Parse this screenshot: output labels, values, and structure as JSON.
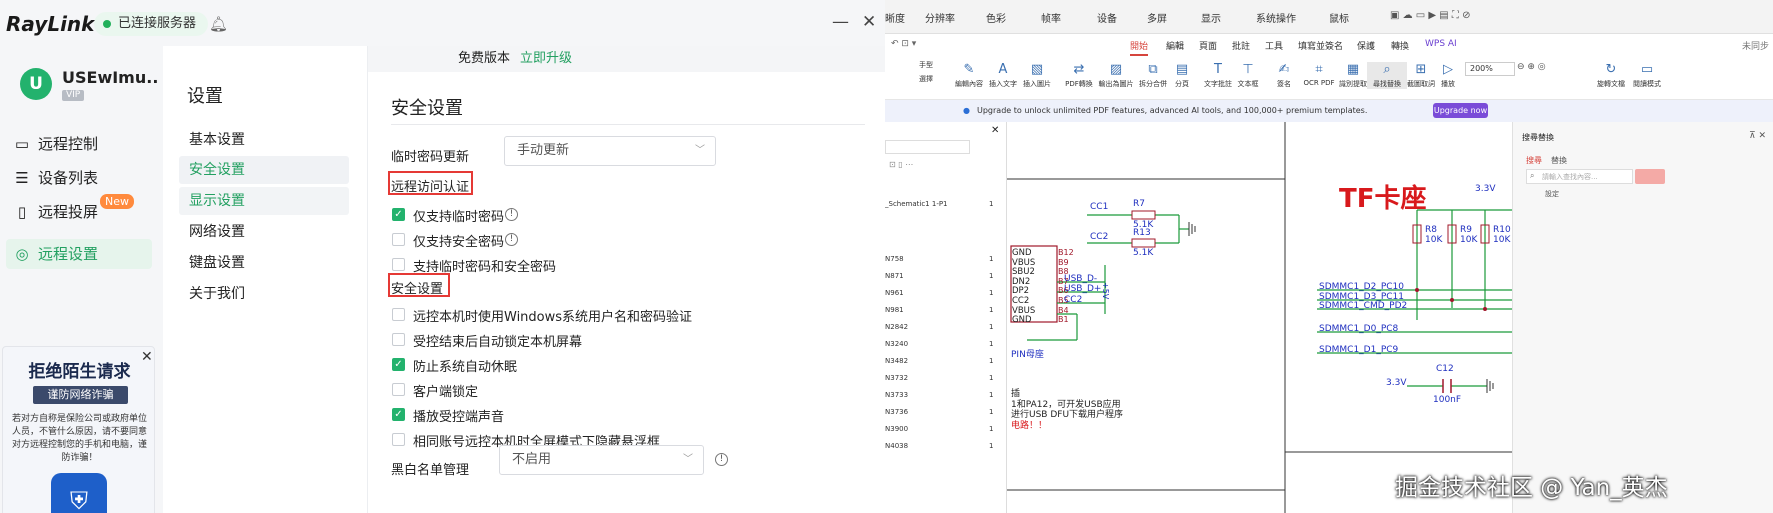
{
  "raylink": {
    "logo": "RayLink",
    "status": "已连接服务器",
    "user": {
      "initial": "U",
      "name": "USEwImu..",
      "badge": "VIP"
    },
    "nav": [
      {
        "label": "远程控制",
        "icon": "monitor-icon"
      },
      {
        "label": "设备列表",
        "icon": "list-icon"
      },
      {
        "label": "远程投屏",
        "icon": "cast-icon"
      },
      {
        "label": "远程设置",
        "icon": "settings-icon",
        "active": true
      }
    ],
    "new_badge": "New",
    "ad": {
      "title": "拒绝陌生请求",
      "subtitle": "谨防网络诈骗",
      "body": "若对方自称是保险公司或政府单位人员，不管什么原因，请不要同意对方远程控制您的手机和电脑，谨防诈骗！"
    },
    "banner": {
      "edition": "免费版本",
      "upgrade": "立即升级"
    },
    "submenu": {
      "title": "设置",
      "items": [
        "基本设置",
        "安全设置",
        "显示设置",
        "网络设置",
        "键盘设置",
        "关于我们"
      ]
    },
    "main": {
      "title": "安全设置",
      "temp_pwd_label": "临时密码更新",
      "temp_pwd_value": "手动更新",
      "section_auth": "远程访问认证",
      "auth_options": [
        {
          "label": "仅支持临时密码",
          "checked": true,
          "info": true
        },
        {
          "label": "仅支持安全密码",
          "checked": false,
          "info": true
        },
        {
          "label": "支持临时密码和安全密码",
          "checked": false,
          "info": false
        }
      ],
      "section_security": "安全设置",
      "security_options": [
        {
          "label": "远控本机时使用Windows系统用户名和密码验证",
          "checked": false
        },
        {
          "label": "受控结束后自动锁定本机屏幕",
          "checked": false
        },
        {
          "label": "防止系统自动休眠",
          "checked": true
        },
        {
          "label": "客户端锁定",
          "checked": false
        },
        {
          "label": "播放受控端声音",
          "checked": true
        },
        {
          "label": "相同账号远控本机时全屏模式下隐藏悬浮框",
          "checked": false
        }
      ],
      "blacklist_label": "黑白名单管理",
      "blacklist_value": "不启用"
    }
  },
  "pdf": {
    "top_toolbar": [
      "晰度",
      "分辨率",
      "色彩",
      "帧率",
      "设备",
      "多屏",
      "显示",
      "系统操作",
      "鼠标"
    ],
    "menus": [
      "開始",
      "編輯",
      "頁面",
      "批註",
      "工具",
      "填寫並簽名",
      "保護",
      "轉換",
      "WPS AI"
    ],
    "unsynced": "未同步",
    "tools": [
      "手型",
      "選擇",
      "編輯內容",
      "插入文字",
      "插入圖片",
      "PDF轉換",
      "輸出為圖片",
      "拆分合併",
      "分頁",
      "文字批註",
      "文本框",
      "簽名",
      "OCR PDF",
      "識別提取",
      "尋找替換",
      "截圖取詞",
      "播放",
      "旋轉文檔",
      "閱讀模式"
    ],
    "zoom": "200%",
    "upgrade_text": "Upgrade to unlock unlimited PDF features, advanced AI tools, and 100,000+ premium templates.",
    "upgrade_btn": "Upgrade now",
    "nav_rows": [
      {
        "label": "_Schematic1 1-P1",
        "num": "1"
      },
      {
        "label": "N758",
        "num": "1"
      },
      {
        "label": "N871",
        "num": "1"
      },
      {
        "label": "N961",
        "num": "1"
      },
      {
        "label": "N981",
        "num": "1"
      },
      {
        "label": "N2842",
        "num": "1"
      },
      {
        "label": "N3240",
        "num": "1"
      },
      {
        "label": "N3482",
        "num": "1"
      },
      {
        "label": "N3732",
        "num": "1"
      },
      {
        "label": "N3733",
        "num": "1"
      },
      {
        "label": "N3736",
        "num": "1"
      },
      {
        "label": "N3900",
        "num": "1"
      },
      {
        "label": "N4038",
        "num": "1"
      }
    ],
    "schematic": {
      "title": "TF卡座",
      "cc1": "CC1",
      "cc2": "CC2",
      "r7": "R7",
      "r7v": "5.1K",
      "r13": "R13",
      "r13v": "5.1K",
      "pins": [
        "GND",
        "VBUS",
        "SBU2",
        "DN2",
        "DP2",
        "CC2",
        "VBUS",
        "GND"
      ],
      "pinnums": [
        "B12",
        "B9",
        "B8",
        "B7",
        "B6",
        "B5",
        "B4",
        "B1"
      ],
      "usb_dm": "USB_D-",
      "usb_dp": "USB_D+",
      "cc2b": "CC2",
      "v5": "+5V",
      "connector": "PIN母座",
      "note1": "插",
      "note2": "1和PA12，可开发USB应用",
      "note3": "进行USB DFU下载用户程序",
      "note4": "电路！！",
      "v33": "3.3V",
      "r8": "R8",
      "r8v": "10K",
      "r9": "R9",
      "r9v": "10K",
      "r10": "R10",
      "r10v": "10K",
      "nets": [
        "SDMMC1_D2_PC10",
        "SDMMC1_D3_PC11",
        "SDMMC1_CMD_PD2",
        "SDMMC1_D0_PC8",
        "SDMMC1_D1_PC9"
      ],
      "c12": "C12",
      "c12v": "100nF",
      "v33b": "3.3V"
    },
    "search_panel": {
      "title": "搜尋替換",
      "tab_search": "搜尋",
      "tab_replace": "替換",
      "placeholder": "請輸入查找內容...",
      "settings": "設定"
    },
    "watermark": "掘金技术社区 @ Yan_英杰"
  }
}
